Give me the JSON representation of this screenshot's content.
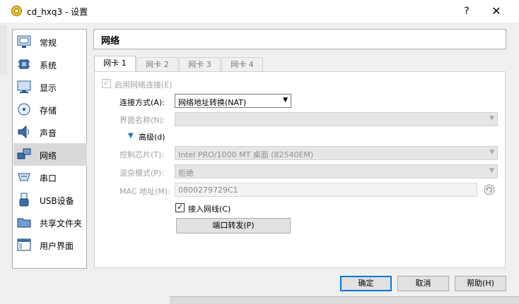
{
  "window": {
    "title": "cd_hxq3 - 设置",
    "help_label": "?",
    "close_label": "✕"
  },
  "sidebar": {
    "items": [
      {
        "label": "常规",
        "icon": "general-icon"
      },
      {
        "label": "系统",
        "icon": "system-icon"
      },
      {
        "label": "显示",
        "icon": "display-icon"
      },
      {
        "label": "存储",
        "icon": "storage-icon"
      },
      {
        "label": "声音",
        "icon": "audio-icon"
      },
      {
        "label": "网络",
        "icon": "network-icon",
        "selected": true
      },
      {
        "label": "串口",
        "icon": "serial-port-icon"
      },
      {
        "label": "USB设备",
        "icon": "usb-icon"
      },
      {
        "label": "共享文件夹",
        "icon": "shared-folder-icon"
      },
      {
        "label": "用户界面",
        "icon": "user-interface-icon"
      }
    ]
  },
  "header": {
    "title": "网络"
  },
  "tabs": [
    {
      "label": "网卡 1",
      "active": true
    },
    {
      "label": "网卡 2"
    },
    {
      "label": "网卡 3"
    },
    {
      "label": "网卡 4"
    }
  ],
  "form": {
    "enable_label": "启用网络连接(E)",
    "enable_checked": true,
    "attach_label": "连接方式(A):",
    "attach_value": "网络地址转换(NAT)",
    "name_label": "界面名称(N):",
    "name_value": "",
    "advanced_label": "高级(d)",
    "adapter_label": "控制芯片(T):",
    "adapter_value": "Intel PRO/1000 MT 桌面 (82540EM)",
    "promisc_label": "混杂模式(P):",
    "promisc_value": "拒绝",
    "mac_label": "MAC 地址(M):",
    "mac_value": "0800279729C1",
    "cable_label": "接入网线(C)",
    "cable_checked": true,
    "port_forward_label": "端口转发(P)"
  },
  "buttons": {
    "ok": "确定",
    "cancel": "取消",
    "help": "帮助(H)"
  },
  "colors": {
    "accent": "#0078d7",
    "selected_bg": "#d9d9d9",
    "dialog_bg": "#f0f0f0"
  }
}
